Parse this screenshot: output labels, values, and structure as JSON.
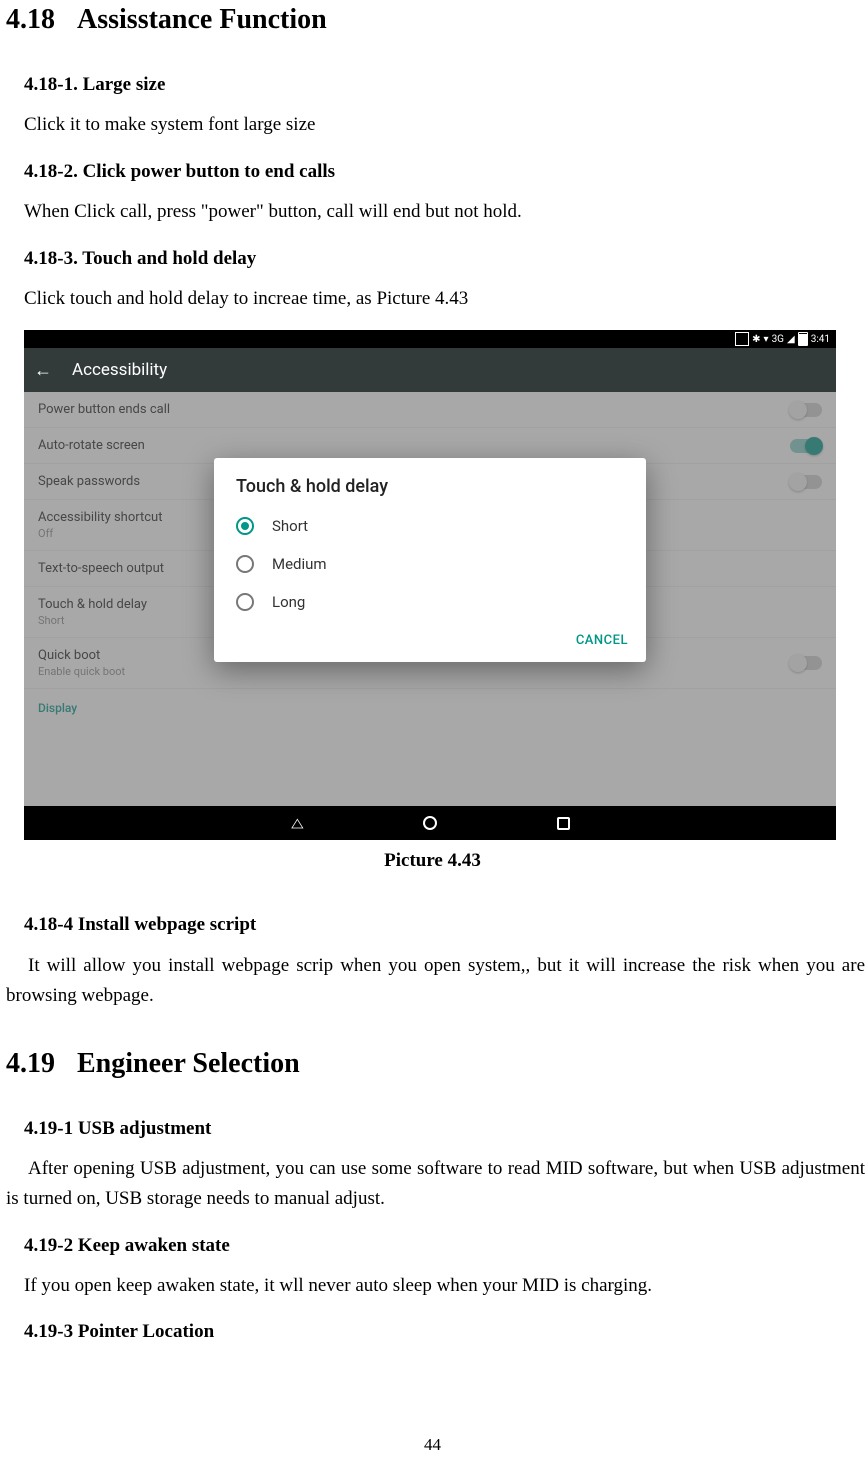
{
  "section1": {
    "num": "4.18",
    "title": "Assisstance Function",
    "items": [
      {
        "h": "4.18-1. Large size",
        "p": "Click it to make system font large size"
      },
      {
        "h": "4.18-2. Click power button to end calls",
        "p": "When Click call, press \"power\" button, call will end but not hold."
      },
      {
        "h": "4.18-3. Touch and hold delay",
        "p": "Click touch and hold delay to increae time, as Picture 4.43"
      }
    ]
  },
  "screenshot": {
    "statusbar": {
      "net": "3G",
      "time": "3:41"
    },
    "appbar_title": "Accessibility",
    "rows": [
      {
        "label": "Power button ends call",
        "sub": "",
        "switch": "off"
      },
      {
        "label": "Auto-rotate screen",
        "sub": "",
        "switch": "on"
      },
      {
        "label": "Speak passwords",
        "sub": "",
        "switch": "off"
      },
      {
        "label": "Accessibility shortcut",
        "sub": "Off",
        "switch": ""
      },
      {
        "label": "Text-to-speech output",
        "sub": "",
        "switch": ""
      },
      {
        "label": "Touch & hold delay",
        "sub": "Short",
        "switch": ""
      },
      {
        "label": "Quick boot",
        "sub": "Enable quick boot",
        "switch": "off"
      },
      {
        "label": "Display",
        "sub": "",
        "switch": "",
        "cat": true
      }
    ],
    "dialog": {
      "title": "Touch & hold delay",
      "options": [
        "Short",
        "Medium",
        "Long"
      ],
      "selected": 0,
      "cancel": "CANCEL"
    }
  },
  "caption": "Picture 4.43",
  "section1b": {
    "h": "4.18-4 Install webpage script",
    "p": "It will allow you install webpage scrip when you open system,, but it will increase the risk when you are browsing webpage."
  },
  "section2": {
    "num": "4.19",
    "title": "Engineer Selection",
    "items": [
      {
        "h": "4.19-1 USB adjustment",
        "p": "After opening USB adjustment, you can use some software to read MID software, but when USB adjustment is turned on, USB storage needs to manual adjust."
      },
      {
        "h": "4.19-2 Keep awaken state",
        "p": "If you open keep awaken state, it wll never auto sleep when your MID is charging."
      },
      {
        "h": "4.19-3 Pointer Location",
        "p": ""
      }
    ]
  },
  "page_number": "44"
}
